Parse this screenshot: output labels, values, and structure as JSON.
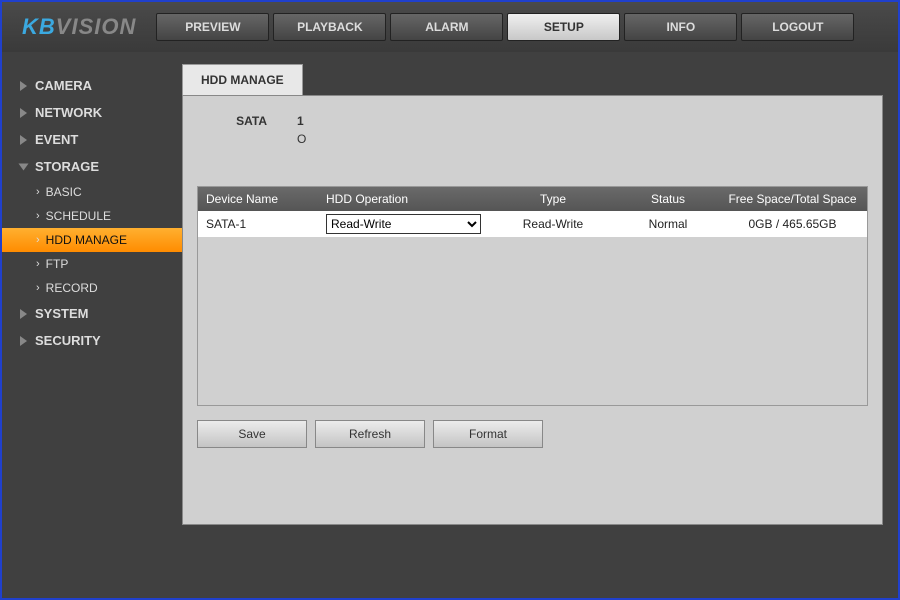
{
  "brand": {
    "kb": "KB",
    "vision": "VISION"
  },
  "topnav": {
    "preview": "PREVIEW",
    "playback": "PLAYBACK",
    "alarm": "ALARM",
    "setup": "SETUP",
    "info": "INFO",
    "logout": "LOGOUT"
  },
  "sidebar": {
    "camera": "CAMERA",
    "network": "NETWORK",
    "event": "EVENT",
    "storage": "STORAGE",
    "storage_items": {
      "basic": "BASIC",
      "schedule": "SCHEDULE",
      "hdd_manage": "HDD MANAGE",
      "ftp": "FTP",
      "record": "RECORD"
    },
    "system": "SYSTEM",
    "security": "SECURITY"
  },
  "panel": {
    "tab": "HDD MANAGE",
    "sata_label": "SATA",
    "sata_num": "1",
    "sata_status": "O"
  },
  "table": {
    "headers": {
      "device": "Device Name",
      "operation": "HDD Operation",
      "type": "Type",
      "status": "Status",
      "space": "Free Space/Total Space"
    },
    "row": {
      "device": "SATA-1",
      "operation_selected": "Read-Write",
      "type": "Read-Write",
      "status": "Normal",
      "space": "0GB / 465.65GB"
    }
  },
  "buttons": {
    "save": "Save",
    "refresh": "Refresh",
    "format": "Format"
  }
}
